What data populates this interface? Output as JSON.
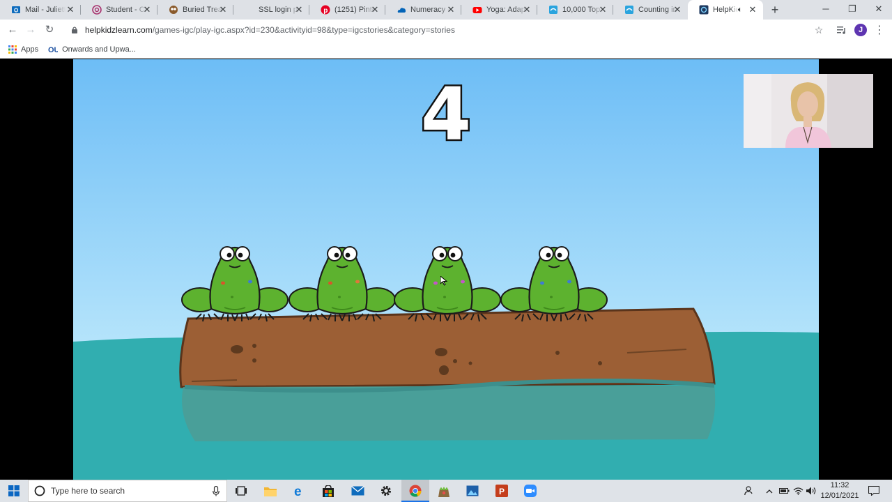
{
  "browser": {
    "tabs": [
      {
        "title": "Mail - Juliette",
        "icon": "outlook-icon"
      },
      {
        "title": "Student - CP",
        "icon": "target-icon"
      },
      {
        "title": "Buried Treasure",
        "icon": "owl-icon"
      },
      {
        "title": "SSL login page",
        "icon": "blank-icon"
      },
      {
        "title": "(1251) Pinterest",
        "icon": "pinterest-icon"
      },
      {
        "title": "Numeracy -",
        "icon": "onedrive-icon"
      },
      {
        "title": "Yoga: Adapted",
        "icon": "youtube-icon"
      },
      {
        "title": "10,000 Top C",
        "icon": "twinkl-icon"
      },
      {
        "title": "Counting in",
        "icon": "twinkl-icon"
      },
      {
        "title": "HelpKidzLearn",
        "icon": "helpkidzlearn-icon",
        "active": true
      }
    ],
    "url_host": "helpkidzlearn.com",
    "url_path": "/games-igc/play-igc.aspx?id=230&activityid=98&type=igcstories&category=stories",
    "avatar_letter": "J",
    "bookmarks": [
      {
        "label": "Apps",
        "icon": "apps-grid-icon"
      },
      {
        "label": "Onwards and Upwa...",
        "icon": "ou-icon"
      }
    ]
  },
  "game": {
    "count": "4",
    "frog_count": 4,
    "colors": {
      "sky_top": "#6dbdf6",
      "sky_bottom": "#b7e5fb",
      "water": "#31aeb0",
      "log": "#9c5f35",
      "frog": "#5db22f"
    }
  },
  "taskbar": {
    "search_placeholder": "Type here to search",
    "time": "11:32",
    "date": "12/01/2021"
  }
}
